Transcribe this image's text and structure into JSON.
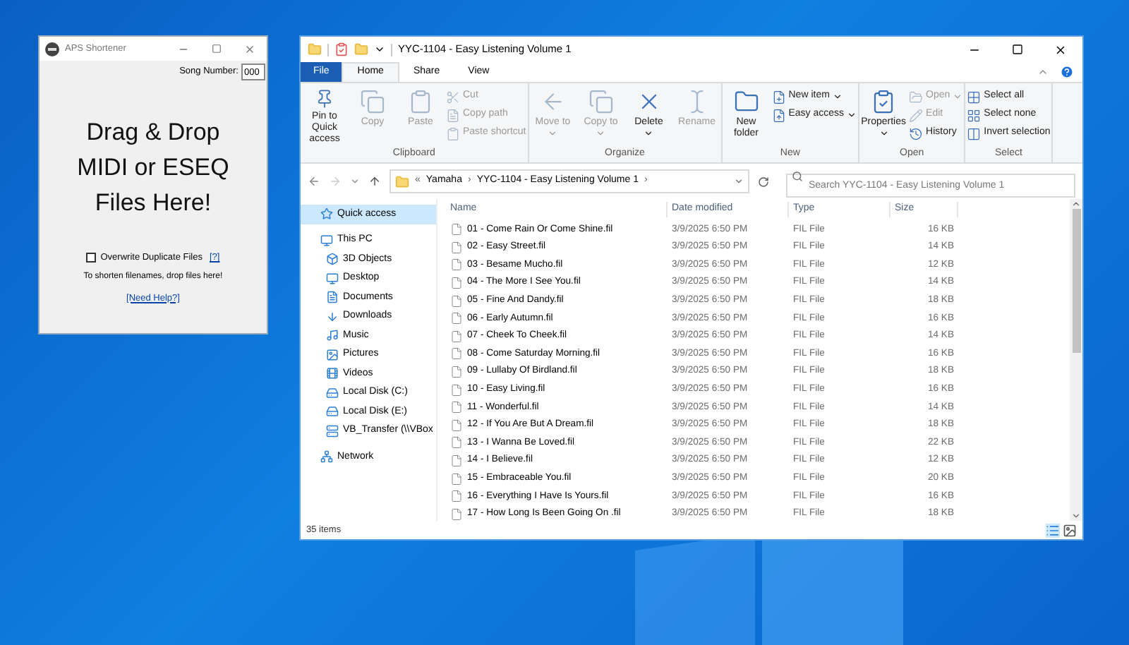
{
  "aps_window": {
    "title": "APS Shortener",
    "song_number_label": "Song Number:",
    "song_number_value": "000",
    "drop_lines": [
      "Drag & Drop",
      "MIDI or ESEQ",
      "Files Here!"
    ],
    "overwrite": {
      "label": "Overwrite Duplicate Files",
      "checked": false
    },
    "overwrite_help": "[?]",
    "hint": "To shorten filenames, drop files here!",
    "help_link": "[Need Help?]"
  },
  "explorer": {
    "title": "YYC-1104 - Easy Listening Volume 1",
    "tabs": [
      {
        "label": "File",
        "kind": "file",
        "selected": false
      },
      {
        "label": "Home",
        "kind": "tab",
        "selected": true
      },
      {
        "label": "Share",
        "kind": "tab",
        "selected": false
      },
      {
        "label": "View",
        "kind": "tab",
        "selected": false
      }
    ],
    "ribbon_groups": [
      {
        "label": "Clipboard",
        "items": [
          {
            "label": "Pin to Quick access",
            "kind": "large",
            "disabled": false,
            "dropdown": false
          },
          {
            "label": "Copy",
            "kind": "large",
            "disabled": true,
            "dropdown": false
          },
          {
            "label": "Paste",
            "kind": "large",
            "disabled": true,
            "dropdown": false
          },
          {
            "label": "Cut",
            "kind": "small",
            "disabled": true,
            "dropdown": false
          },
          {
            "label": "Copy path",
            "kind": "small",
            "disabled": true,
            "dropdown": false
          },
          {
            "label": "Paste shortcut",
            "kind": "small",
            "disabled": true,
            "dropdown": false
          }
        ]
      },
      {
        "label": "Organize",
        "items": [
          {
            "label": "Move to",
            "kind": "large",
            "disabled": true,
            "dropdown": true
          },
          {
            "label": "Copy to",
            "kind": "large",
            "disabled": true,
            "dropdown": true
          },
          {
            "label": "Delete",
            "kind": "large",
            "disabled": false,
            "dropdown": true
          },
          {
            "label": "Rename",
            "kind": "large",
            "disabled": true,
            "dropdown": false
          }
        ]
      },
      {
        "label": "New",
        "items": [
          {
            "label": "New folder",
            "kind": "large",
            "disabled": false,
            "dropdown": false
          },
          {
            "label": "New item",
            "kind": "small",
            "disabled": false,
            "dropdown": true
          },
          {
            "label": "Easy access",
            "kind": "small",
            "disabled": false,
            "dropdown": true
          }
        ]
      },
      {
        "label": "Open",
        "items": [
          {
            "label": "Properties",
            "kind": "large",
            "disabled": false,
            "dropdown": true
          },
          {
            "label": "Open",
            "kind": "small",
            "disabled": true,
            "dropdown": true
          },
          {
            "label": "Edit",
            "kind": "small",
            "disabled": true,
            "dropdown": false
          },
          {
            "label": "History",
            "kind": "small",
            "disabled": false,
            "dropdown": false
          }
        ]
      },
      {
        "label": "Select",
        "items": [
          {
            "label": "Select all",
            "kind": "small",
            "disabled": false,
            "dropdown": false
          },
          {
            "label": "Select none",
            "kind": "small",
            "disabled": false,
            "dropdown": false
          },
          {
            "label": "Invert selection",
            "kind": "small",
            "disabled": false,
            "dropdown": false
          }
        ]
      }
    ],
    "address": {
      "overflow": "«",
      "breadcrumb": [
        {
          "label": "Yamaha",
          "separator": "›"
        },
        {
          "label": "YYC-1104 - Easy Listening Volume 1",
          "separator": "›"
        }
      ]
    },
    "search": {
      "placeholder": "Search YYC-1104 - Easy Listening Volume 1"
    },
    "nav": [
      {
        "label": "Quick access",
        "selected": true
      },
      {
        "label": "This PC",
        "selected": false,
        "children": [
          {
            "label": "3D Objects",
            "selected": false
          },
          {
            "label": "Desktop",
            "selected": false
          },
          {
            "label": "Documents",
            "selected": false
          },
          {
            "label": "Downloads",
            "selected": false
          },
          {
            "label": "Music",
            "selected": false
          },
          {
            "label": "Pictures",
            "selected": false
          },
          {
            "label": "Videos",
            "selected": false
          },
          {
            "label": "Local Disk (C:)",
            "selected": false
          },
          {
            "label": "Local Disk (E:)",
            "selected": false
          },
          {
            "label": "VB_Transfer (\\\\VBox",
            "selected": false
          }
        ]
      },
      {
        "label": "Network",
        "selected": false
      }
    ],
    "columns": [
      "Name",
      "Date modified",
      "Type",
      "Size"
    ],
    "rows": [
      [
        "01 - Come Rain Or Come Shine.fil",
        "3/9/2025 6:50 PM",
        "FIL File",
        "16 KB"
      ],
      [
        "02 - Easy Street.fil",
        "3/9/2025 6:50 PM",
        "FIL File",
        "14 KB"
      ],
      [
        "03 - Besame Mucho.fil",
        "3/9/2025 6:50 PM",
        "FIL File",
        "12 KB"
      ],
      [
        "04 - The More I See You.fil",
        "3/9/2025 6:50 PM",
        "FIL File",
        "14 KB"
      ],
      [
        "05 - Fine And Dandy.fil",
        "3/9/2025 6:50 PM",
        "FIL File",
        "18 KB"
      ],
      [
        "06 - Early Autumn.fil",
        "3/9/2025 6:50 PM",
        "FIL File",
        "16 KB"
      ],
      [
        "07 - Cheek To Cheek.fil",
        "3/9/2025 6:50 PM",
        "FIL File",
        "14 KB"
      ],
      [
        "08 - Come Saturday Morning.fil",
        "3/9/2025 6:50 PM",
        "FIL File",
        "16 KB"
      ],
      [
        "09 - Lullaby Of Birdland.fil",
        "3/9/2025 6:50 PM",
        "FIL File",
        "18 KB"
      ],
      [
        "10 - Easy Living.fil",
        "3/9/2025 6:50 PM",
        "FIL File",
        "16 KB"
      ],
      [
        "11 - Wonderful.fil",
        "3/9/2025 6:50 PM",
        "FIL File",
        "14 KB"
      ],
      [
        "12 - If You Are But A Dream.fil",
        "3/9/2025 6:50 PM",
        "FIL File",
        "18 KB"
      ],
      [
        "13 - I Wanna Be Loved.fil",
        "3/9/2025 6:50 PM",
        "FIL File",
        "22 KB"
      ],
      [
        "14 - I Believe.fil",
        "3/9/2025 6:50 PM",
        "FIL File",
        "12 KB"
      ],
      [
        "15 - Embraceable You.fil",
        "3/9/2025 6:50 PM",
        "FIL File",
        "20 KB"
      ],
      [
        "16 - Everything I Have Is Yours.fil",
        "3/9/2025 6:50 PM",
        "FIL File",
        "16 KB"
      ],
      [
        "17 - How Long Is Been Going On .fil",
        "3/9/2025 6:50 PM",
        "FIL File",
        "18 KB"
      ]
    ],
    "status": "35 items"
  }
}
